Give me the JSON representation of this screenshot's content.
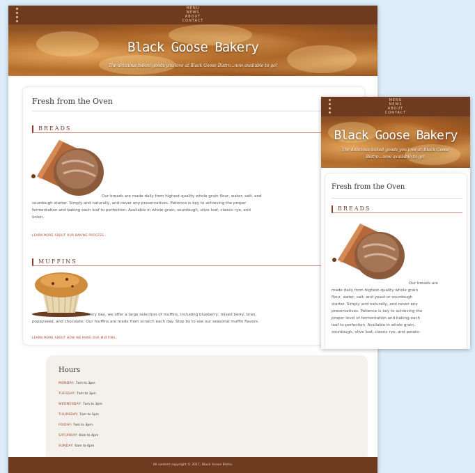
{
  "nav": {
    "items": [
      "MENU",
      "NEWS",
      "ABOUT",
      "CONTACT"
    ]
  },
  "hero": {
    "title": "Black Goose Bakery",
    "subtitle": "The delicious baked goods you love at Black Goose Bistro...now available to go!",
    "subtitle_mobile_1": "The delicious baked goods you love at Black Goose",
    "subtitle_mobile_2": "Bistro...now available to go!"
  },
  "main": {
    "heading": "Fresh from the Oven",
    "breads": {
      "title": "BREADS",
      "text_1": "Our breads are made daily from highest-quality whole grain flour, water, salt, and",
      "text_2": "sourdough starter. Simply and naturally, and never any preservatives. Patience is key to achieving the proper",
      "text_3": "fermentation and baking each loaf to perfection. Available in whole grain, sourdough, olive loaf, classic rye, and",
      "text_4": "onion.",
      "link": "LEARN MORE ABOUT OUR BAKING PROCESS..."
    },
    "muffins": {
      "title": "MUFFINS",
      "text_1": "Every day, we offer a large selection of muffins, including blueberry, mixed berry, bran,",
      "text_2": "poppyseed, and chocolate. Our muffins are made from scratch each day. Stop by to see our seasonal muffin flavors.",
      "link": "LEARN MORE ABOUT HOW WE MAKE OUR MUFFINS..."
    }
  },
  "hours": {
    "title": "Hours",
    "rows": [
      {
        "day": "Monday:",
        "time": "7am to 3pm"
      },
      {
        "day": "Tuesday:",
        "time": "7am to 3pm"
      },
      {
        "day": "Wednesday:",
        "time": "7am to 3pm"
      },
      {
        "day": "Thursday:",
        "time": "7am to 3pm"
      },
      {
        "day": "Friday:",
        "time": "7am to 3pm"
      },
      {
        "day": "Saturday:",
        "time": "6am to 4pm"
      },
      {
        "day": "Sunday:",
        "time": "6am to 4pm"
      }
    ]
  },
  "footer": {
    "text": "All content copyright © 2017, Black Goose Bistro."
  },
  "mobile": {
    "breads_lines": [
      "Our breads are",
      "made daily from highest-quality whole grain",
      "flour, water, salt, and yeast or sourdough",
      "starter. Simply and naturally, and never any",
      "preservatives. Patience is key to achieving the",
      "proper level of fermentation and baking each",
      "loaf to perfection. Available in whole grain,",
      "sourdough, olive loaf, classic rye, and potato-"
    ]
  },
  "colors": {
    "brown": "#6e3a20",
    "accent": "#8c3a2c",
    "link": "#b2431f"
  }
}
